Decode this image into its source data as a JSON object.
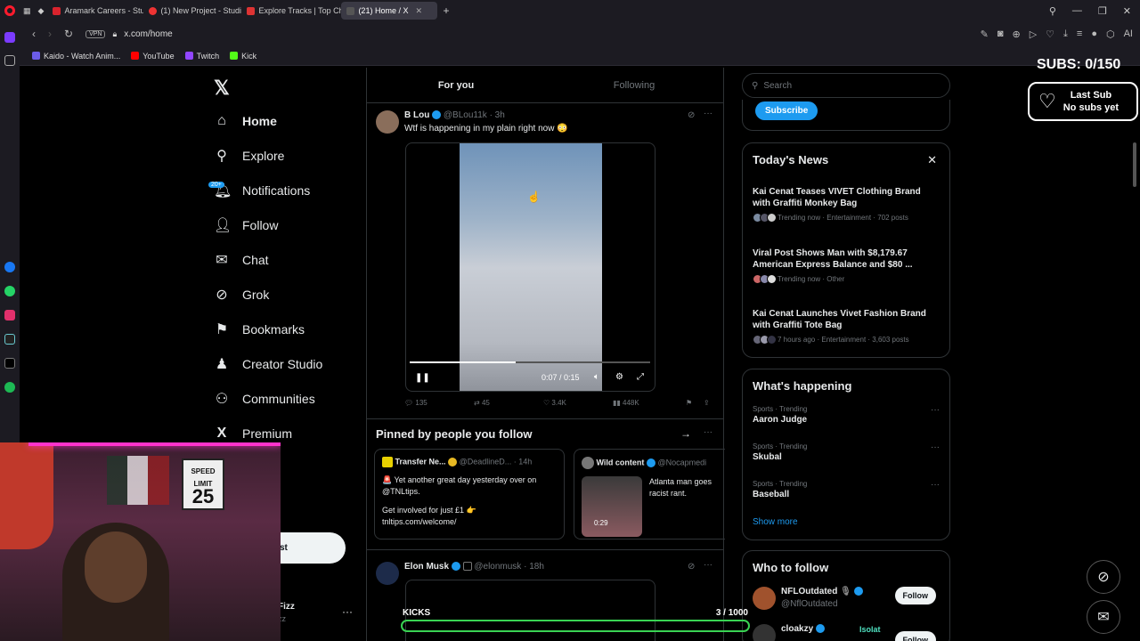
{
  "browser": {
    "tabs": [
      {
        "title": "Aramark Careers - Student",
        "color": "#d9232d"
      },
      {
        "title": "(1) New Project - Studio",
        "color": "#e33"
      },
      {
        "title": "Explore Tracks | Top Chart",
        "color": "#d33"
      },
      {
        "title": "(21) Home / X",
        "color": "#555",
        "active": true
      }
    ],
    "new_tab": "+",
    "vpn": "VPN",
    "url": "x.com/home",
    "bookmarks": [
      {
        "label": "Kaido - Watch Anim...",
        "color": "#6c5ce7"
      },
      {
        "label": "YouTube",
        "color": "#ff0000"
      },
      {
        "label": "Twitch",
        "color": "#9146ff"
      },
      {
        "label": "Kick",
        "color": "#53fc18"
      }
    ],
    "ai_label": "AI"
  },
  "xnav": {
    "items": [
      {
        "label": "Home",
        "icon": "home-icon",
        "glyph": "⌂"
      },
      {
        "label": "Explore",
        "icon": "search-icon",
        "glyph": "⚲"
      },
      {
        "label": "Notifications",
        "icon": "bell-icon",
        "glyph": "🔔︎",
        "badge": "20+"
      },
      {
        "label": "Follow",
        "icon": "follow-icon",
        "glyph": "👤︎"
      },
      {
        "label": "Chat",
        "icon": "mail-icon",
        "glyph": "✉"
      },
      {
        "label": "Grok",
        "icon": "grok-icon",
        "glyph": "⊘"
      },
      {
        "label": "Bookmarks",
        "icon": "bookmark-icon",
        "glyph": "⚑"
      },
      {
        "label": "Creator Studio",
        "icon": "creator-icon",
        "glyph": "♟"
      },
      {
        "label": "Communities",
        "icon": "communities-icon",
        "glyph": "⚇"
      },
      {
        "label": "Premium",
        "icon": "x-premium-icon",
        "glyph": "X"
      }
    ],
    "post_button_fragment": "st",
    "account_name_fragment": "Fizz",
    "account_handle_fragment": "zz"
  },
  "timeline": {
    "tabs": [
      "For you",
      "Following"
    ],
    "post1": {
      "name": "B Lou",
      "handle": "@BLou11k",
      "time": "· 3h",
      "text": "Wtf is happening in my plain right now 😳",
      "video_time": "0:07 / 0:15",
      "progress": 0.44,
      "replies": "135",
      "reposts": "45",
      "likes": "3.4K",
      "views": "448K"
    },
    "pinned": {
      "title": "Pinned by people you follow",
      "cards": [
        {
          "name": "Transfer Ne...",
          "handle": "@DeadlineD...",
          "time": "· 14h",
          "text1": "🚨 Yet another great day yesterday over on @TNLtips.",
          "text2": "Get involved for just £1 👉 tnltips.com/welcome/"
        },
        {
          "name": "Wild content",
          "handle": "@Nocapmedi",
          "text": "Atlanta man goes racist rant.",
          "duration": "0:29"
        }
      ]
    },
    "post2": {
      "name": "Elon Musk",
      "handle": "@elonmusk",
      "time": "· 18h"
    }
  },
  "right": {
    "search_placeholder": "Search",
    "subscribe": "Subscribe",
    "news": {
      "title": "Today's News",
      "items": [
        {
          "headline": "Kai Cenat Teases VIVET Clothing Brand with Graffiti Monkey Bag",
          "meta": "Trending now · Entertainment · 702 posts"
        },
        {
          "headline": "Viral Post Shows Man with $8,179.67 American Express Balance and $80 ...",
          "meta": "Trending now · Other"
        },
        {
          "headline": "Kai Cenat Launches Vivet Fashion Brand with Graffiti Tote Bag",
          "meta": "7 hours ago · Entertainment · 3,603 posts"
        }
      ]
    },
    "happening": {
      "title": "What's happening",
      "trends": [
        {
          "category": "Sports · Trending",
          "name": "Aaron Judge"
        },
        {
          "category": "Sports · Trending",
          "name": "Skubal"
        },
        {
          "category": "Sports · Trending",
          "name": "Baseball"
        }
      ],
      "show_more": "Show more"
    },
    "who_to_follow": {
      "title": "Who to follow",
      "accounts": [
        {
          "name": "NFLOutdated",
          "handle": "@NflOutdated",
          "button": "Follow"
        },
        {
          "name": "cloakzy",
          "handle": "",
          "button": "Follow"
        }
      ]
    }
  },
  "overlay": {
    "subs": "SUBS: 0/150",
    "last_sub_title": "Last Sub",
    "last_sub_value": "No subs yet",
    "kicks_label": "KICKS",
    "kicks_count": "3 / 1000",
    "kicks_progress": 0.003,
    "webcam_sign_top": "SPEED",
    "webcam_sign_mid": "LIMIT",
    "webcam_sign_num": "25",
    "wtf_overlap_text": "Isolat"
  }
}
